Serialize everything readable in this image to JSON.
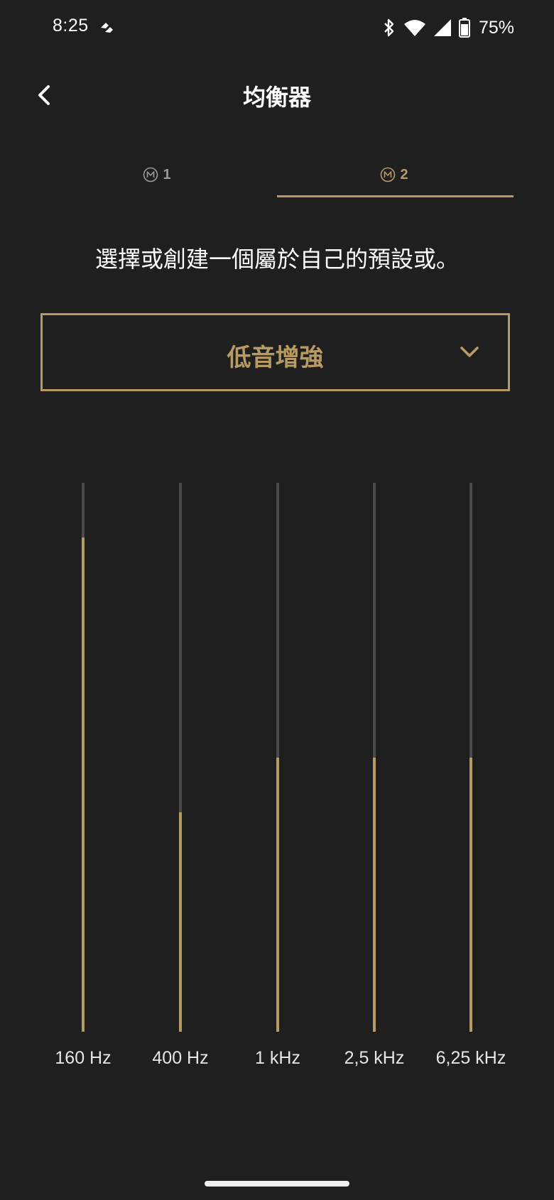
{
  "status_bar": {
    "time": "8:25",
    "battery_percent": "75%",
    "icons": [
      "app-notification-icon",
      "bluetooth-icon",
      "wifi-icon",
      "cellular-signal-icon",
      "battery-icon"
    ]
  },
  "header": {
    "title": "均衡器",
    "back_icon": "chevron-left-icon"
  },
  "tabs": [
    {
      "label": "1",
      "icon": "m-circle-icon",
      "selected": false
    },
    {
      "label": "2",
      "icon": "m-circle-icon",
      "selected": true
    }
  ],
  "instruction": "選擇或創建一個屬於自己的預設或。",
  "preset": {
    "selected": "低音增強",
    "icon": "chevron-down-icon"
  },
  "equalizer": {
    "bands": [
      {
        "label": "160 Hz",
        "level": 0.9
      },
      {
        "label": "400 Hz",
        "level": 0.4
      },
      {
        "label": "1 kHz",
        "level": 0.5
      },
      {
        "label": "2,5 kHz",
        "level": 0.5
      },
      {
        "label": "6,25 kHz",
        "level": 0.5
      }
    ]
  },
  "colors": {
    "accent": "#b89b62",
    "background": "#1f1f1f",
    "track": "#4a4a4a",
    "inactive_tab": "#9a9a9a"
  }
}
